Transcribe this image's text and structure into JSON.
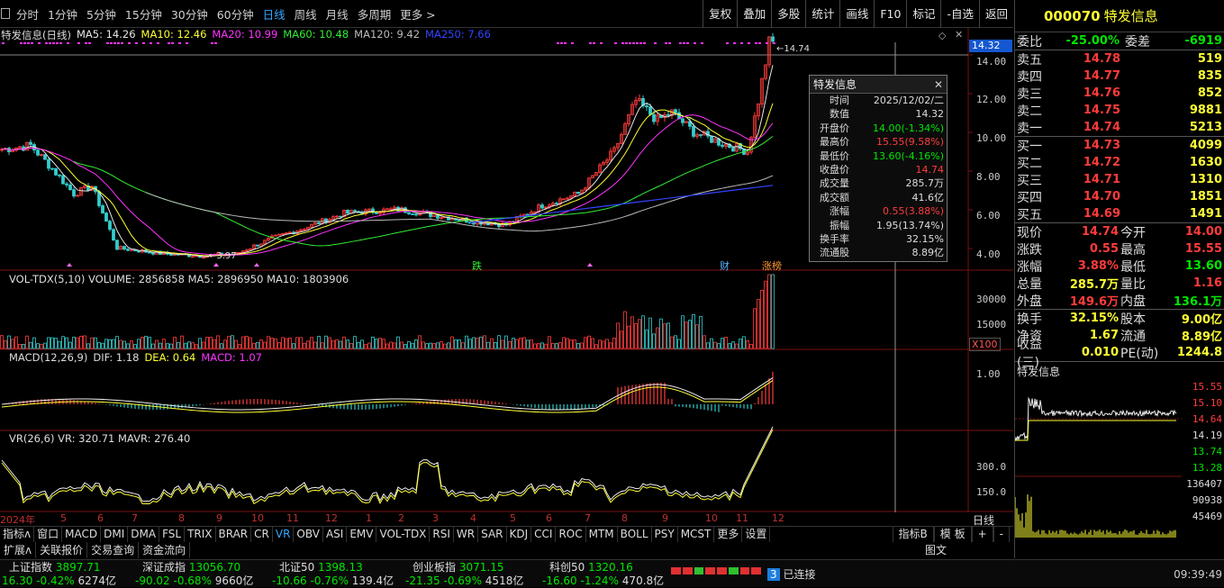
{
  "toolbar": {
    "periods": [
      "分时",
      "1分钟",
      "5分钟",
      "15分钟",
      "30分钟",
      "60分钟",
      "日线",
      "周线",
      "月线",
      "多周期",
      "更多 >"
    ],
    "tools": [
      "复权",
      "叠加",
      "多股",
      "统计",
      "画线",
      "F10",
      "标记",
      "-自选",
      "返回"
    ]
  },
  "main_indicator": {
    "name": "特发信息(日线)",
    "ma5": "MA5: 14.26",
    "ma10": "MA10: 12.46",
    "ma20": "MA20: 10.99",
    "ma60": "MA60: 10.48",
    "ma120": "MA120: 9.42",
    "ma250": "MA250: 7.66"
  },
  "price_axis": {
    "current": "14.32",
    "ticks": [
      "14.00",
      "12.00",
      "10.00",
      "8.00",
      "6.00",
      "4.00"
    ],
    "high_mark": "14.74",
    "low_mark": "3.97"
  },
  "markers": {
    "m1": "跌",
    "m2": "财",
    "m3": "涨榜"
  },
  "vol": {
    "header": "VOL-TDX(5,10)  VOLUME: 2856858  MA5: 2896950  MA10: 1803906",
    "ticks": [
      "30000",
      "15000"
    ],
    "unit": "X100"
  },
  "macd": {
    "header_name": "MACD(12,26,9)",
    "dif": "DIF: 1.18",
    "dea": "DEA: 0.64",
    "macd": "MACD: 1.07",
    "tick": "1.00"
  },
  "vr": {
    "header": "VR(26,6)  VR: 320.71  MAVR: 276.40",
    "ticks": [
      "300.0",
      "150.0"
    ]
  },
  "xaxis": [
    "2024年",
    "5",
    "6",
    "7",
    "8",
    "9",
    "10",
    "11",
    "12",
    "1",
    "2",
    "3",
    "4",
    "5",
    "6",
    "7",
    "8",
    "9",
    "10",
    "11",
    "12"
  ],
  "popup": {
    "title": "特发信息",
    "rows": [
      {
        "k": "时间",
        "v": "2025/12/02/二",
        "c": "#ddd"
      },
      {
        "k": "数值",
        "v": "14.32",
        "c": "#ddd"
      },
      {
        "k": "开盘价",
        "v": "14.00(-1.34%)",
        "c": "#00e600"
      },
      {
        "k": "最高价",
        "v": "15.55(9.58%)",
        "c": "#ff3c3c"
      },
      {
        "k": "最低价",
        "v": "13.60(-4.16%)",
        "c": "#00e600"
      },
      {
        "k": "收盘价",
        "v": "14.74",
        "c": "#ff3c3c"
      },
      {
        "k": "成交量",
        "v": "285.7万",
        "c": "#ddd"
      },
      {
        "k": "成交额",
        "v": "41.6亿",
        "c": "#ddd"
      },
      {
        "k": "涨幅",
        "v": "0.55(3.88%)",
        "c": "#ff3c3c"
      },
      {
        "k": "振幅",
        "v": "1.95(13.74%)",
        "c": "#ddd"
      },
      {
        "k": "换手率",
        "v": "32.15%",
        "c": "#ddd"
      },
      {
        "k": "流通股",
        "v": "8.89亿",
        "c": "#ddd"
      }
    ]
  },
  "tabs": [
    "指标ʌ",
    "窗口",
    "MACD",
    "DMI",
    "DMA",
    "FSL",
    "TRIX",
    "BRAR",
    "CR",
    "VR",
    "OBV",
    "ASI",
    "EMV",
    "VOL-TDX",
    "RSI",
    "WR",
    "SAR",
    "KDJ",
    "CCI",
    "ROC",
    "MTM",
    "BOLL",
    "PSY",
    "MCST",
    "更多",
    "设置"
  ],
  "tabs_right": [
    "指标B",
    "模 板",
    "+",
    "-"
  ],
  "tabs2": [
    "扩展ʌ",
    "关联报价",
    "交易查询",
    "资金流向"
  ],
  "status": {
    "indices": [
      {
        "name": "上证指数",
        "val": "3897.71",
        "chg": "16.30",
        "pct": "-0.42%",
        "amt": "6274亿"
      },
      {
        "name": "深证成指",
        "val": "13056.70",
        "chg": "-90.02",
        "pct": "-0.68%",
        "amt": "9660亿"
      },
      {
        "name": "北证50",
        "val": "1398.13",
        "chg": "-10.66",
        "pct": "-0.76%",
        "amt": "139.4亿"
      },
      {
        "name": "创业板指",
        "val": "3071.15",
        "chg": "-21.35",
        "pct": "-0.69%",
        "amt": "4518亿"
      },
      {
        "name": "科创50",
        "val": "1320.16",
        "chg": "-16.60",
        "pct": "-1.24%",
        "amt": "470.8亿"
      }
    ],
    "connected": "已连接",
    "conn_num": "3",
    "time": "09:39:49"
  },
  "quote": {
    "code": "000070",
    "name": "特发信息",
    "weibi_label": "委比",
    "weibi": "-25.00%",
    "weicha_label": "委差",
    "weicha": "-6919",
    "asks": [
      {
        "n": "卖五",
        "p": "14.78",
        "v": "519"
      },
      {
        "n": "卖四",
        "p": "14.77",
        "v": "835"
      },
      {
        "n": "卖三",
        "p": "14.76",
        "v": "852"
      },
      {
        "n": "卖二",
        "p": "14.75",
        "v": "9881"
      },
      {
        "n": "卖一",
        "p": "14.74",
        "v": "5213"
      }
    ],
    "bids": [
      {
        "n": "买一",
        "p": "14.73",
        "v": "4099"
      },
      {
        "n": "买二",
        "p": "14.72",
        "v": "1630"
      },
      {
        "n": "买三",
        "p": "14.71",
        "v": "1310"
      },
      {
        "n": "买四",
        "p": "14.70",
        "v": "1851"
      },
      {
        "n": "买五",
        "p": "14.69",
        "v": "1491"
      }
    ],
    "stats1": [
      {
        "k1": "现价",
        "v1": "14.74",
        "c1": "red",
        "k2": "今开",
        "v2": "14.00",
        "c2": "red"
      },
      {
        "k1": "涨跌",
        "v1": "0.55",
        "c1": "red",
        "k2": "最高",
        "v2": "15.55",
        "c2": "red"
      },
      {
        "k1": "涨幅",
        "v1": "3.88%",
        "c1": "red",
        "k2": "最低",
        "v2": "13.60",
        "c2": "grn"
      },
      {
        "k1": "总量",
        "v1": "285.7万",
        "c1": "yel",
        "k2": "量比",
        "v2": "1.16",
        "c2": "red"
      },
      {
        "k1": "外盘",
        "v1": "149.6万",
        "c1": "red",
        "k2": "内盘",
        "v2": "136.1万",
        "c2": "grn"
      }
    ],
    "stats2": [
      {
        "k1": "换手",
        "v1": "32.15%",
        "c1": "yel",
        "k2": "股本",
        "v2": "9.00亿",
        "c2": "yel"
      },
      {
        "k1": "净资",
        "v1": "1.67",
        "c1": "yel",
        "k2": "流通",
        "v2": "8.89亿",
        "c2": "yel"
      },
      {
        "k1": "收益(三)",
        "v1": "0.010",
        "c1": "yel",
        "k2": "PE(动)",
        "v2": "1244.8",
        "c2": "yel"
      }
    ],
    "mini_title": "特发信息",
    "mini_ticks": [
      "15.55",
      "15.10",
      "14.64",
      "14.19",
      "13.74",
      "13.28",
      "136407",
      "90938",
      "45469"
    ]
  },
  "colors": {
    "ma5": "#e6e6e6",
    "ma10": "#ffff33",
    "ma20": "#ff33ff",
    "ma60": "#33ee33",
    "ma120": "#bbbbbb",
    "ma250": "#3344ff",
    "up": "#ff3c3c",
    "down": "#33cccc"
  }
}
